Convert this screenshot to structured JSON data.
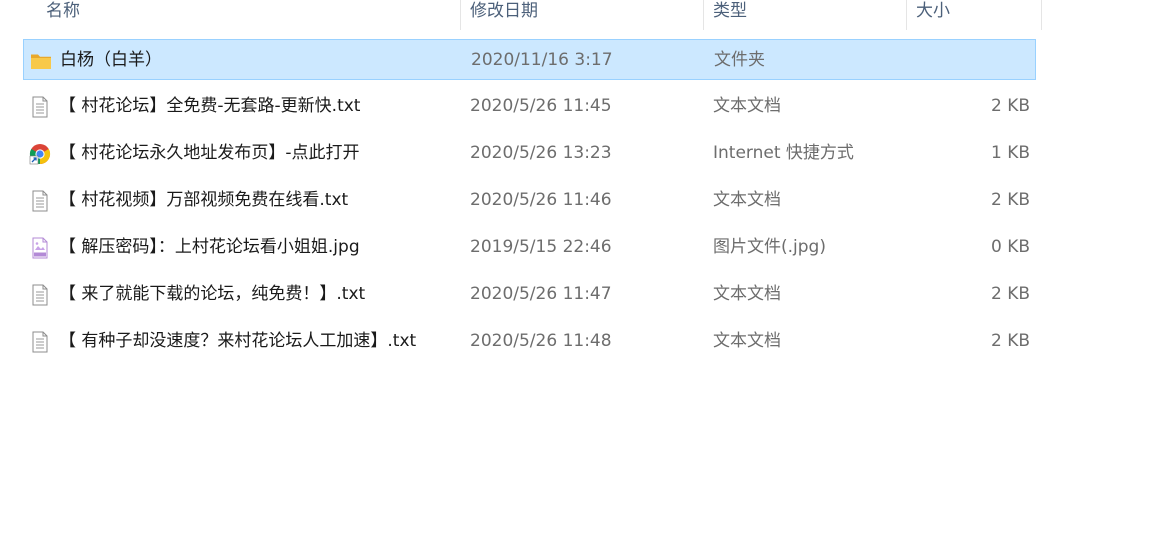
{
  "header": {
    "name": "名称",
    "date": "修改日期",
    "type": "类型",
    "size": "大小"
  },
  "files": [
    {
      "icon": "folder-icon",
      "name": "白杨（白羊）",
      "date": "2020/11/16 3:17",
      "type": "文件夹",
      "size": "",
      "selected": true
    },
    {
      "icon": "text-file-icon",
      "name": "【 村花论坛】全免费-无套路-更新快.txt",
      "date": "2020/5/26 11:45",
      "type": "文本文档",
      "size": "2 KB",
      "selected": false
    },
    {
      "icon": "chrome-shortcut-icon",
      "name": "【 村花论坛永久地址发布页】-点此打开",
      "date": "2020/5/26 13:23",
      "type": "Internet 快捷方式",
      "size": "1 KB",
      "selected": false
    },
    {
      "icon": "text-file-icon",
      "name": "【 村花视频】万部视频免费在线看.txt",
      "date": "2020/5/26 11:46",
      "type": "文本文档",
      "size": "2 KB",
      "selected": false
    },
    {
      "icon": "jpg-image-icon",
      "name": "【 解压密码】：上村花论坛看小姐姐.jpg",
      "date": "2019/5/15 22:46",
      "type": "图片文件(.jpg)",
      "size": "0 KB",
      "selected": false
    },
    {
      "icon": "text-file-icon",
      "name": "【 来了就能下载的论坛，纯免费！】.txt",
      "date": "2020/5/26 11:47",
      "type": "文本文档",
      "size": "2 KB",
      "selected": false
    },
    {
      "icon": "text-file-icon",
      "name": "【 有种子却没速度？来村花论坛人工加速】.txt",
      "date": "2020/5/26 11:48",
      "type": "文本文档",
      "size": "2 KB",
      "selected": false
    }
  ],
  "colors": {
    "selection_bg": "#cce8ff",
    "selection_border": "#99d1ff",
    "header_text": "#4c607a",
    "secondary_text": "#6d6d6d"
  }
}
